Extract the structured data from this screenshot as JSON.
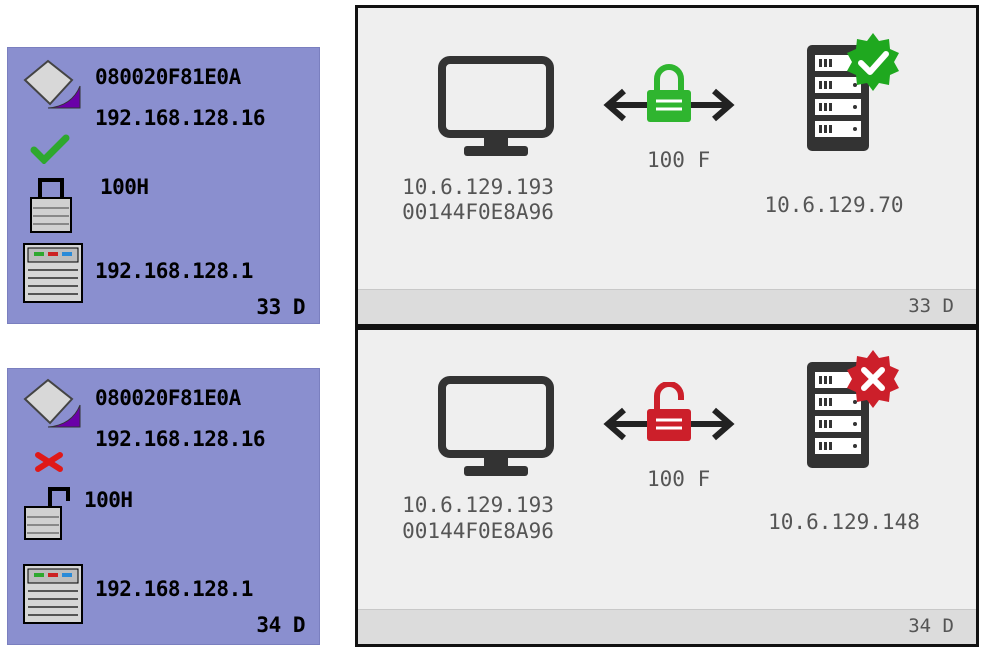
{
  "legacy_panels": [
    {
      "mac": "080020F81E0A",
      "ip": "192.168.128.16",
      "link": "100H",
      "gateway": "192.168.128.1",
      "days": "33 D",
      "status": "ok",
      "lock": "locked"
    },
    {
      "mac": "080020F81E0A",
      "ip": "192.168.128.16",
      "link": "100H",
      "gateway": "192.168.128.1",
      "days": "34 D",
      "status": "error",
      "lock": "unlocked"
    }
  ],
  "modern_panels": [
    {
      "client_ip": "10.6.129.193",
      "client_mac": "00144F0E8A96",
      "link": "100 F",
      "server_ip": "10.6.129.70",
      "days": "33 D",
      "status": "ok",
      "lock": "locked",
      "status_color": "#1fa81f"
    },
    {
      "client_ip": "10.6.129.193",
      "client_mac": "00144F0E8A96",
      "link": "100 F",
      "server_ip": "10.6.129.148",
      "days": "34 D",
      "status": "error",
      "lock": "unlocked",
      "status_color": "#cc1f2a"
    }
  ],
  "icons": [
    "disk-icon",
    "checkmark-icon",
    "error-x-icon",
    "padlock-locked-icon",
    "padlock-unlocked-icon",
    "server-icon",
    "monitor-icon",
    "double-arrow-icon",
    "server-rack-icon",
    "status-badge-icon"
  ]
}
